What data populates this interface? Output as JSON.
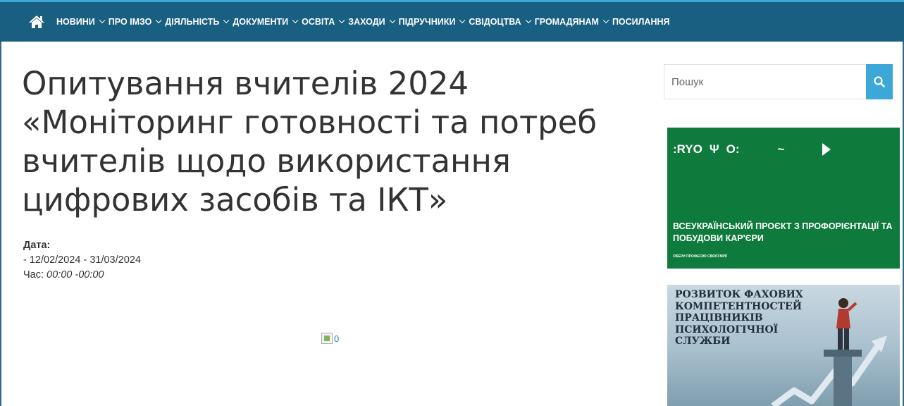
{
  "nav": {
    "home_icon": "home-icon",
    "items": [
      {
        "label": "НОВИНИ",
        "dropdown": true
      },
      {
        "label": "ПРО ІМЗО",
        "dropdown": true
      },
      {
        "label": "ДІЯЛЬНІСТЬ",
        "dropdown": true
      },
      {
        "label": "ДОКУМЕНТИ",
        "dropdown": true
      },
      {
        "label": "ОСВІТА",
        "dropdown": true
      },
      {
        "label": "ЗАХОДИ",
        "dropdown": true
      },
      {
        "label": "ПІДРУЧНИКИ",
        "dropdown": true
      },
      {
        "label": "СВІДОЦТВА",
        "dropdown": true
      },
      {
        "label": "ГРОМАДЯНАМ",
        "dropdown": true
      },
      {
        "label": "ПОСИЛАННЯ",
        "dropdown": false
      }
    ],
    "background": "#185f81"
  },
  "article": {
    "title": "Опитування вчителів 2024 «Моніторинг готовності та потреб вчителів щодо використання цифрових засобів та ІКТ»",
    "date_label": "Дата:",
    "date_range": "- 12/02/2024 - 31/03/2024",
    "time_label": "Час:",
    "time_value": "00:00 -00:00",
    "image_alt": "0"
  },
  "sidebar": {
    "search": {
      "placeholder": "Пошук",
      "button_icon": "search-icon",
      "button_color": "#3ba8d8"
    },
    "banner1": {
      "logos": [
        ":RYO",
        "O:"
      ],
      "title": "ВСЕУКРАЇНСЬКИЙ ПРОЄКТ З ПРОФОРІЄНТАЦІЇ ТА ПОБУДОВИ КАР'ЄРИ",
      "subtitle": "ОБЕРИ ПРОФЕСІЮ СВОЄЇ МРІЇ",
      "background": "#0e7a3c"
    },
    "banner2": {
      "title": "РОЗВИТОК ФАХОВИХ КОМПЕТЕНТНОСТЕЙ ПРАЦІВНИКІВ ПСИХОЛОГІЧНОЇ СЛУЖБИ"
    }
  }
}
